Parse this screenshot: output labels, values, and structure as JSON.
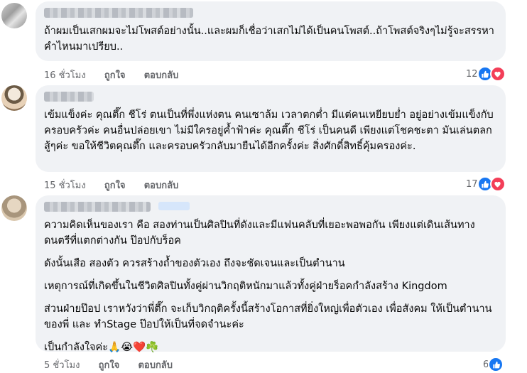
{
  "comments": [
    {
      "paragraphs": [
        "ถ้าผมเป็นเสกผมจะไม่โพสต์อย่างนั้น..และผมก็เชื่อว่าเสกไม่ได้เป็นคนโพสต์..ถ้าโพสต์จริงๆไม่รู้จะสรรหาคำไหนมาเปรียบ.."
      ],
      "time": "16 ชั่วโมง",
      "like_label": "ถูกใจ",
      "reply_label": "ตอบกลับ",
      "reaction_count": "12",
      "reactions": [
        "like-icon",
        "love-icon"
      ]
    },
    {
      "paragraphs": [
        "เข้มแข็งค่ะ คุณตึ๊ก ชีโร่ ตนเป็นที่พึ่งแห่งตน คนเซาล้ม เวลาตกต่ำ มีแต่คนเหยียบย่ำ อยู่อย่างเข้มแข็งกับครอบครัวค่ะ คนอื่นปล่อยเขา ไม่มีใครอยู่ค้ำฟ้าค่ะ คุณตึ๊ก ชีโร่ เป็นคนดี เพียงแต่โชคชะตา มันเล่นตลก สู้ๆค่ะ ขอให้ชีวิตคุณตึ๊ก และครอบครัวกลับมายืนได้อีกครั้งค่ะ สิ่งศักดิ์สิทธิ์คุ้มครองค่ะ."
      ],
      "time": "15 ชั่วโมง",
      "like_label": "ถูกใจ",
      "reply_label": "ตอบกลับ",
      "reaction_count": "17",
      "reactions": [
        "like-icon",
        "love-icon"
      ]
    },
    {
      "paragraphs": [
        "ความคิดเห็นของเรา คือ สองท่านเป็นศิลปินที่ดังและมีแฟนคลับที่เยอะพอพอกัน เพียงแต่เดินเส้นทางดนตรีที่แตกต่างกัน ป๊อปกับร็อค",
        "ดังนั้นเสือ สองตัว ควรสร้างถ้ำของตัวเอง ถึงจะชัดเจนและเป็นตำนาน",
        "เหตุการณ์ที่เกิดขึ้นในชีวิตศิลปินทั้งคู่ผ่านวิกฤติหนักมาแล้วทั้งคู่ฝ่ายร็อคกำลังสร้าง Kingdom",
        "ส่วนฝ่ายป๊อป เราหวังว่าพี่ตึ๊ก จะเก็บวิกฤติครั้งนี้สร้างโอกาสที่ยิ่งใหญ่เพื่อตัวเอง เพื่อสังคม ให้เป็นตำนานของพี่ และ ทำStage ป๊อปให้เป็นที่จดจำนะค่ะ",
        "เป็นกำลังใจค่ะ🙏😭❤️☘️"
      ],
      "time": "5 ชั่วโมง",
      "like_label": "ถูกใจ",
      "reply_label": "ตอบกลับ",
      "reaction_count": "6",
      "reactions": [
        "like-icon"
      ]
    }
  ]
}
